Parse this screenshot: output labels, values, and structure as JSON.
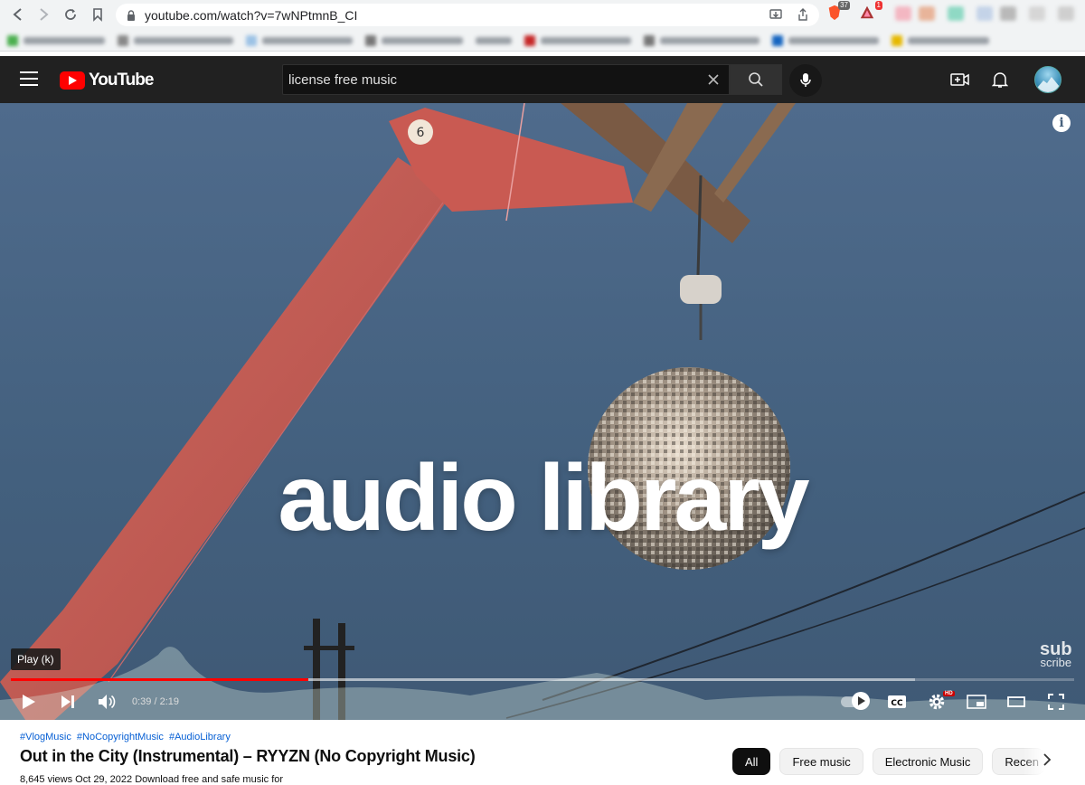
{
  "browser": {
    "url": "youtube.com/watch?v=7wNPtmnB_CI",
    "brave_shield_count": "37",
    "rewards_count": "1"
  },
  "header": {
    "logo_text": "YouTube",
    "search_value": "license free music"
  },
  "player": {
    "overlay_title": "audio library",
    "tooltip": "Play (k)",
    "time_current": "0:39",
    "time_total": "2:19",
    "progress_fraction": 0.28,
    "buffered_fraction": 0.85,
    "subscribe_logo_line1": "sub",
    "subscribe_logo_line2": "scribe",
    "hd_label": "HD"
  },
  "video": {
    "hashtags": [
      "#VlogMusic",
      "#NoCopyrightMusic",
      "#AudioLibrary"
    ],
    "title": "Out in the City (Instrumental) – RYYZN (No Copyright Music)",
    "meta": "8,645 views  Oct 29, 2022  Download free and safe music for"
  },
  "chips": {
    "items": [
      "All",
      "Free music",
      "Electronic Music",
      "Recen"
    ]
  },
  "colors": {
    "yt_red": "#ff0000",
    "header_bg": "#212121",
    "link_blue": "#065fd4"
  }
}
